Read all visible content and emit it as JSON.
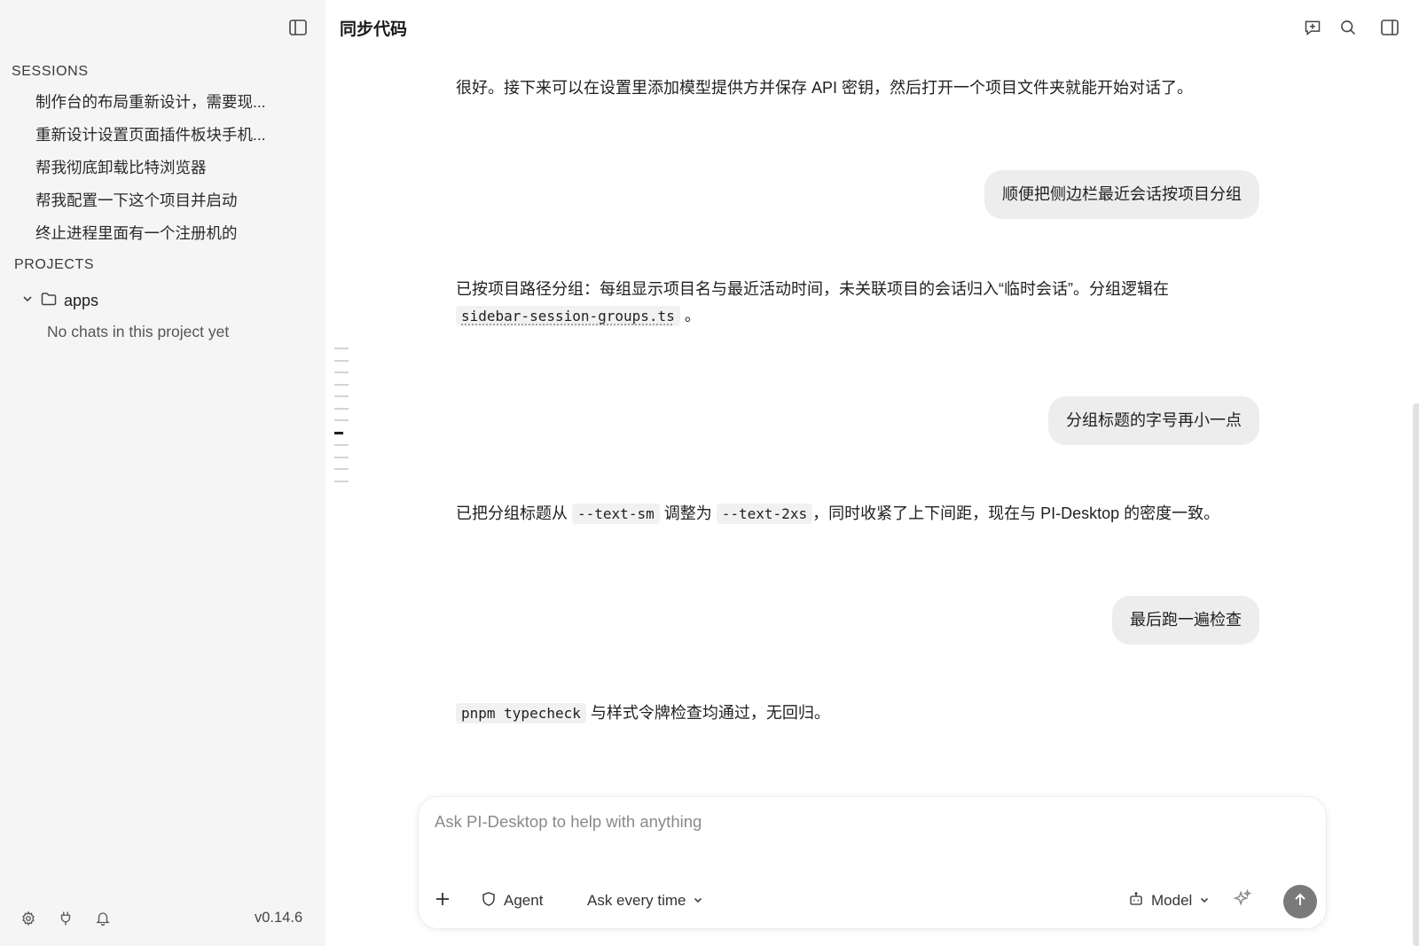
{
  "sidebar": {
    "sessions_heading": "SESSIONS",
    "sessions": [
      {
        "label": "制作台的布局重新设计，需要现..."
      },
      {
        "label": "重新设计设置页面插件板块手机..."
      },
      {
        "label": "帮我彻底卸载比特浏览器"
      },
      {
        "label": "帮我配置一下这个项目并启动"
      },
      {
        "label": "终止进程里面有一个注册机的"
      }
    ],
    "projects_heading": "PROJECTS",
    "project": {
      "name": "apps",
      "empty_note": "No chats in this project yet"
    },
    "version": "v0.14.6"
  },
  "main": {
    "title": "同步代码",
    "messages": {
      "ai1": "很好。接下来可以在设置里添加模型提供方并保存 API 密钥，然后打开一个项目文件夹就能开始对话了。",
      "user1": "顺便把侧边栏最近会话按项目分组",
      "ai2_text": "已按项目路径分组：每组显示项目名与最近活动时间，未关联项目的会话归入“临时会话”。分组逻辑在",
      "ai2_code": "sidebar-session-groups.ts",
      "ai2_end": "。",
      "user2": "分组标题的字号再小一点",
      "ai3_a": "已把分组标题从",
      "ai3_code1": "--text-sm",
      "ai3_b": "调整为",
      "ai3_code2": "--text-2xs",
      "ai3_c": "，同时收紧了上下间距，现在与 PI-Desktop 的密度一致。",
      "user3": "最后跑一遍检查",
      "ai4_code": "pnpm typecheck",
      "ai4_text": "与样式令牌检查均通过，无回归。"
    }
  },
  "composer": {
    "placeholder": "Ask PI-Desktop to help with anything",
    "agent_label": "Agent",
    "permission_label": "Ask every time",
    "model_label": "Model"
  },
  "icons": {
    "sidebar_toggle": "sidebar-toggle-icon",
    "new_chat": "new-chat-icon",
    "search": "search-icon",
    "right_panel": "right-panel-icon",
    "folder": "folder-icon",
    "chevron": "chevron-down-icon",
    "settings": "gear-icon",
    "plugin": "plug-icon",
    "notifications": "bell-icon",
    "attach": "plus-icon",
    "agent": "shield-icon",
    "model": "robot-icon",
    "enhance": "sparkles-icon",
    "send": "arrow-up-icon"
  },
  "colors": {
    "sidebar_bg": "#f5f5f5",
    "user_bubble": "#ededed",
    "send_button": "#7a7a7a"
  }
}
